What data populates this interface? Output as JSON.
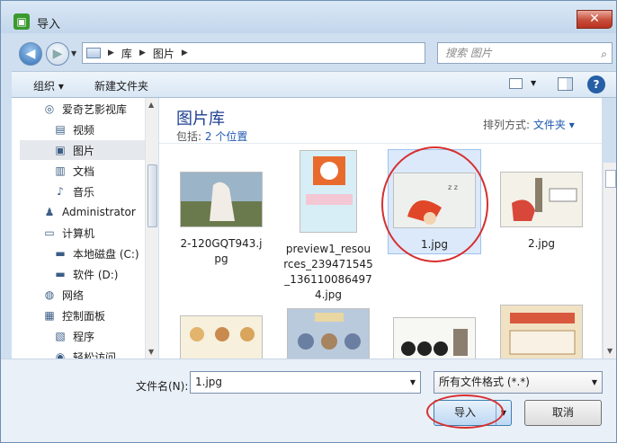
{
  "window": {
    "title": "导入",
    "close_label": "✕"
  },
  "address_bar": {
    "crumbs": [
      "库",
      "图片"
    ],
    "search_placeholder": "搜索 图片"
  },
  "toolbar": {
    "organize": "组织 ▾",
    "new_folder": "新建文件夹"
  },
  "nav": {
    "items": [
      {
        "label": "爱奇艺影视库",
        "icon": "app-icon"
      },
      {
        "label": "视频",
        "icon": "video-icon"
      },
      {
        "label": "图片",
        "icon": "picture-icon",
        "selected": true
      },
      {
        "label": "文档",
        "icon": "document-icon"
      },
      {
        "label": "音乐",
        "icon": "music-icon"
      },
      {
        "label": "Administrator",
        "icon": "user-icon"
      },
      {
        "label": "计算机",
        "icon": "computer-icon"
      },
      {
        "label": "本地磁盘 (C:)",
        "icon": "drive-icon"
      },
      {
        "label": "软件 (D:)",
        "icon": "drive-icon"
      },
      {
        "label": "网络",
        "icon": "network-icon"
      },
      {
        "label": "控制面板",
        "icon": "control-panel-icon"
      },
      {
        "label": "程序",
        "icon": "program-icon"
      },
      {
        "label": "轻松访问",
        "icon": "accessibility-icon"
      }
    ]
  },
  "library": {
    "title": "图片库",
    "includes_label": "包括:",
    "locations_link": "2 个位置",
    "arrange_label": "排列方式:",
    "arrange_value": "文件夹 ▾"
  },
  "files": [
    {
      "name": "2-120GQT943.jpg",
      "lines": [
        "2-120GQT943.j",
        "pg"
      ],
      "selected": false
    },
    {
      "name": "preview1_resources_239471545_1361100864974.jpg",
      "lines": [
        "preview1_resou",
        "rces_239471545",
        "_136110086497",
        "4.jpg"
      ],
      "selected": false
    },
    {
      "name": "1.jpg",
      "lines": [
        "1.jpg"
      ],
      "selected": true
    },
    {
      "name": "2.jpg",
      "lines": [
        "2.jpg"
      ],
      "selected": false
    },
    {
      "name": "",
      "lines": [],
      "selected": false
    },
    {
      "name": "",
      "lines": [],
      "selected": false
    },
    {
      "name": "",
      "lines": [],
      "selected": false
    },
    {
      "name": "",
      "lines": [],
      "selected": false
    }
  ],
  "bottom": {
    "file_name_label": "文件名(N):",
    "file_name_value": "1.jpg",
    "file_type": "所有文件格式 (*.*)",
    "import_button": "导入",
    "cancel_button": "取消"
  },
  "colors": {
    "accent": "#1f59b0",
    "annotation": "#d72f2f"
  }
}
